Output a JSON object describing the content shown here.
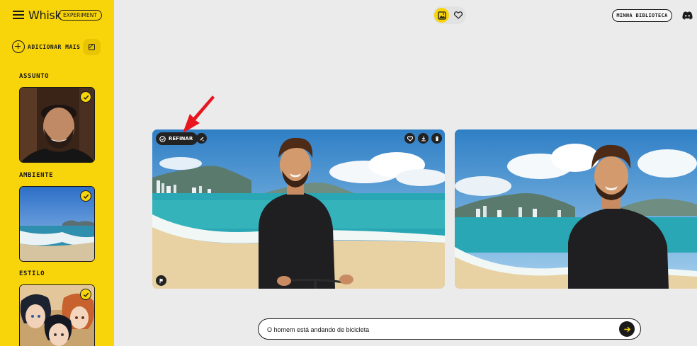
{
  "app": {
    "name": "Whisk",
    "badge": "EXPERIMENT"
  },
  "sidebar": {
    "add_more_label": "ADICIONAR MAIS",
    "sections": [
      {
        "label": "ASSUNTO",
        "selected": true
      },
      {
        "label": "AMBIENTE",
        "selected": true
      },
      {
        "label": "ESTILO",
        "selected": true
      }
    ]
  },
  "header": {
    "toggle": {
      "active": "images-icon",
      "inactive": "heart-icon"
    },
    "library_label": "MINHA BIBLIOTECA",
    "discord_icon": "discord-icon"
  },
  "results": {
    "refine_label": "REFINAR",
    "actions": [
      "heart-icon",
      "download-icon",
      "delete-icon"
    ]
  },
  "prompt": {
    "value": "O homem está andando de bicicleta"
  },
  "colors": {
    "accent": "#f8d40a",
    "background": "#ebebeb",
    "dark": "#1a1a1a",
    "annotation": "#e8141e"
  }
}
